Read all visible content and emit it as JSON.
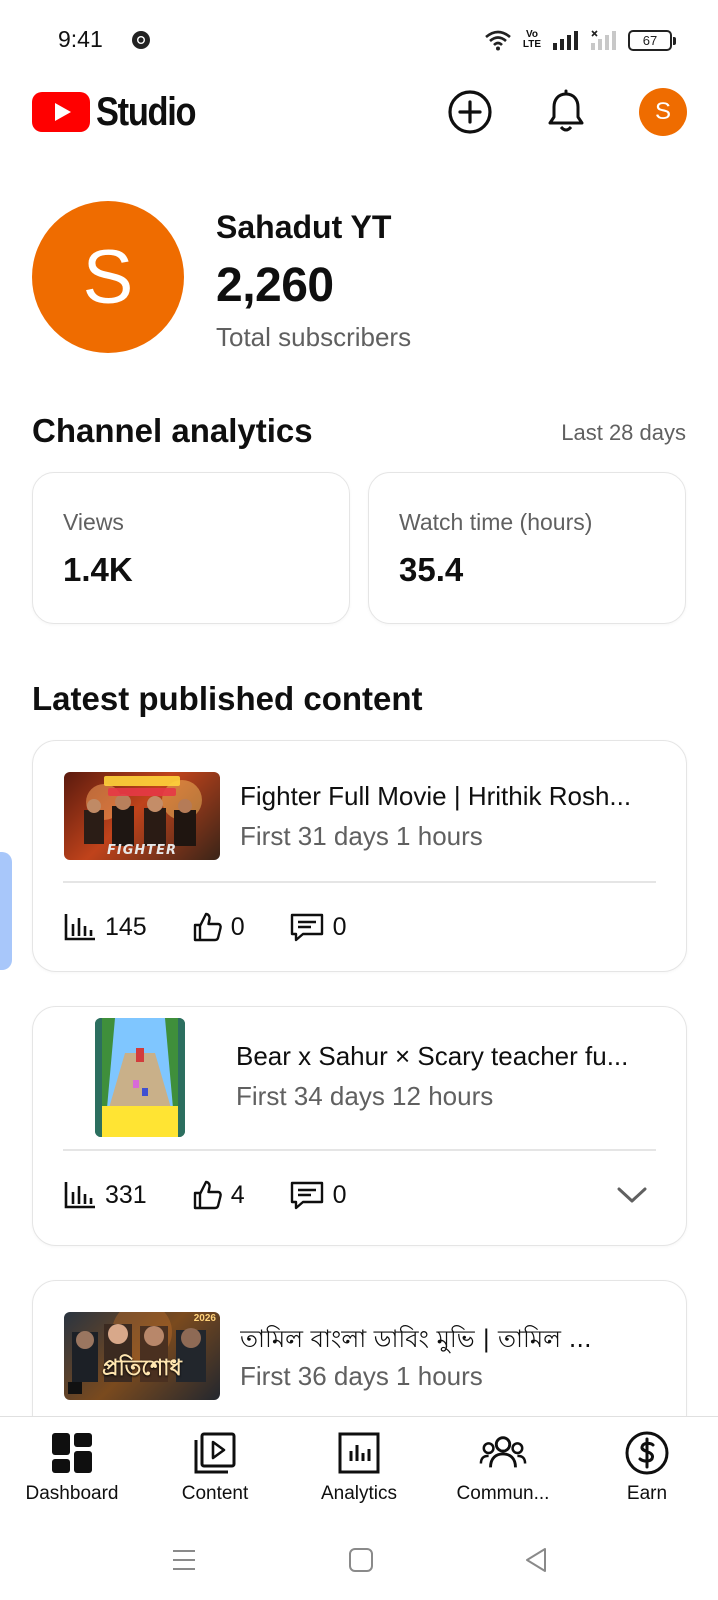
{
  "status_bar": {
    "time": "9:41",
    "volte_top": "Vo",
    "volte_bottom": "LTE",
    "battery": "67"
  },
  "header": {
    "app_name": "Studio",
    "create_icon": "plus-circle-icon",
    "notifications_icon": "bell-icon",
    "account_initial": "S",
    "brand_color": "#ff0000",
    "avatar_color": "#ef6c00"
  },
  "channel": {
    "initial": "S",
    "name": "Sahadut YT",
    "subscriber_count": "2,260",
    "subscriber_label": "Total subscribers"
  },
  "analytics": {
    "title": "Channel analytics",
    "period": "Last 28 days",
    "cards": [
      {
        "label": "Views",
        "value": "1.4K"
      },
      {
        "label": "Watch time (hours)",
        "value": "35.4"
      }
    ]
  },
  "latest": {
    "title": "Latest published content",
    "items": [
      {
        "title": "Fighter Full Movie | Hrithik Rosh...",
        "meta": "First 31 days 1 hours",
        "views": "145",
        "likes": "0",
        "comments": "0",
        "thumb_caption": "FIGHTER"
      },
      {
        "title": "Bear x Sahur × Scary teacher fu...",
        "meta": "First 34 days 12 hours",
        "views": "331",
        "likes": "4",
        "comments": "0"
      },
      {
        "title": "তামিল বাংলা ডাবিং মুভি | তামিল ...",
        "meta": "First 36 days 1 hours",
        "thumb_caption": "প্রতিশোধ",
        "thumb_badge": "2026"
      }
    ]
  },
  "bottom_nav": {
    "items": [
      {
        "label": "Dashboard",
        "icon": "dashboard-icon"
      },
      {
        "label": "Content",
        "icon": "content-icon"
      },
      {
        "label": "Analytics",
        "icon": "analytics-icon"
      },
      {
        "label": "Commun...",
        "icon": "community-icon"
      },
      {
        "label": "Earn",
        "icon": "earn-icon"
      }
    ]
  },
  "system_nav": {
    "menu_icon": "menu-icon",
    "home_icon": "home-icon",
    "back_icon": "back-icon"
  }
}
